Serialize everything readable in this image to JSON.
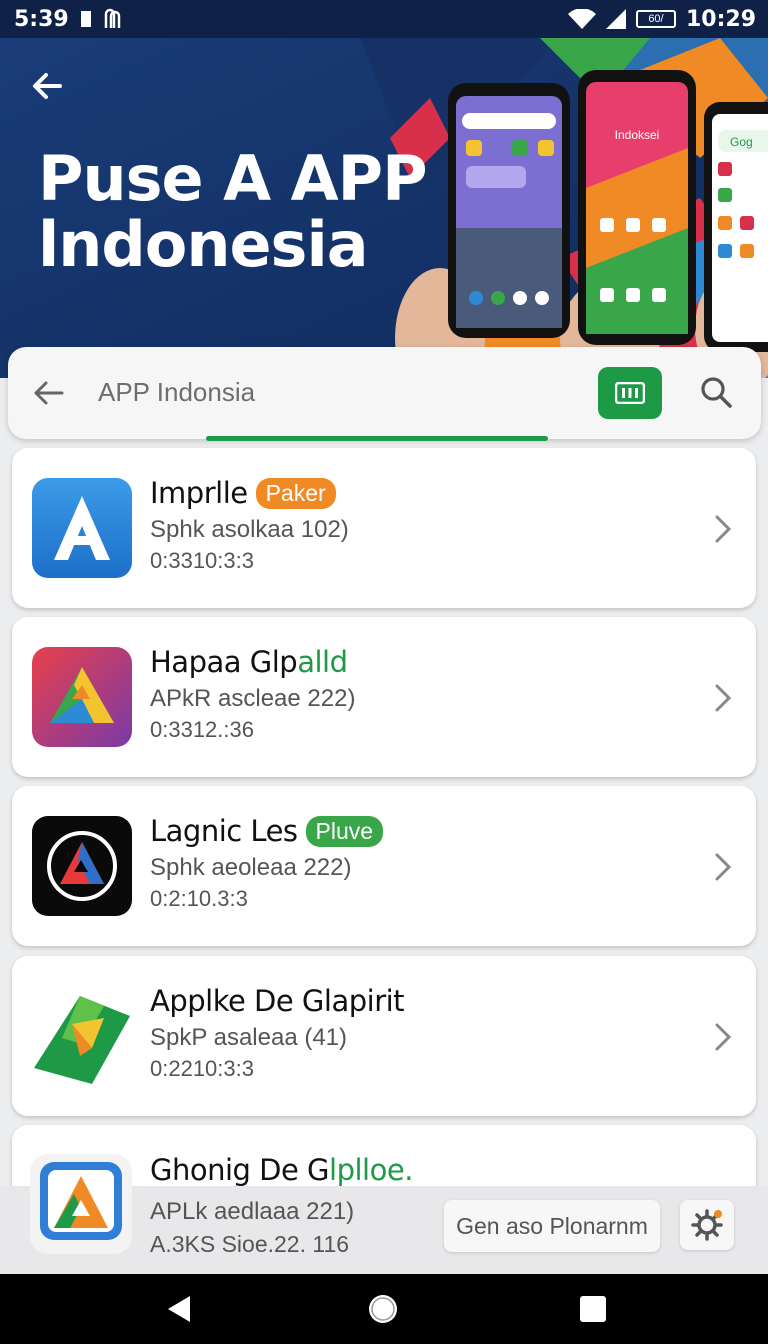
{
  "status_bar": {
    "time_left": "5:39",
    "time_right": "10:29",
    "battery_label": "60/"
  },
  "hero": {
    "title_line1": "Puse A APP",
    "title_line2": "lndonesia",
    "phone_label_center": "Indoksei",
    "phone_label_right": "Gog"
  },
  "search": {
    "placeholder": "APP Indonsia"
  },
  "apps": [
    {
      "name": "Imprlle",
      "badge": "Paker",
      "badge_color": "#f08a24",
      "subtitle": "Sphk asolkaa 102)",
      "meta": "0:3310:3:3",
      "icon": "a-letter-icon"
    },
    {
      "name": "Hapaa Glp",
      "name_accent": "alld",
      "subtitle": "APkR ascleae 222)",
      "meta": "0:3312.:36",
      "icon": "triangle-logo-icon"
    },
    {
      "name": "Lagnic Les",
      "badge": "Pluve",
      "badge_color": "#3aa64a",
      "subtitle": "Sphk aeoleaa 222)",
      "meta": "0:2:10.3:3",
      "icon": "circle-a-icon"
    },
    {
      "name": "Applke De Glapirit",
      "subtitle": "SpkP asaleaa (41)",
      "meta": "0:2210:3:3",
      "icon": "green-shape-icon"
    },
    {
      "name": "Ghonig De G",
      "name_accent": "lplloe.",
      "subtitle": "APLk aedlaaa 221)",
      "meta": "A.3KS Sioe.22. 116",
      "icon": "blue-a-icon"
    }
  ],
  "bottom_bar": {
    "button_label": "Gen aso Plonarnm"
  },
  "colors": {
    "accent_green": "#1e9a47",
    "hero_bg": "#183a73"
  }
}
